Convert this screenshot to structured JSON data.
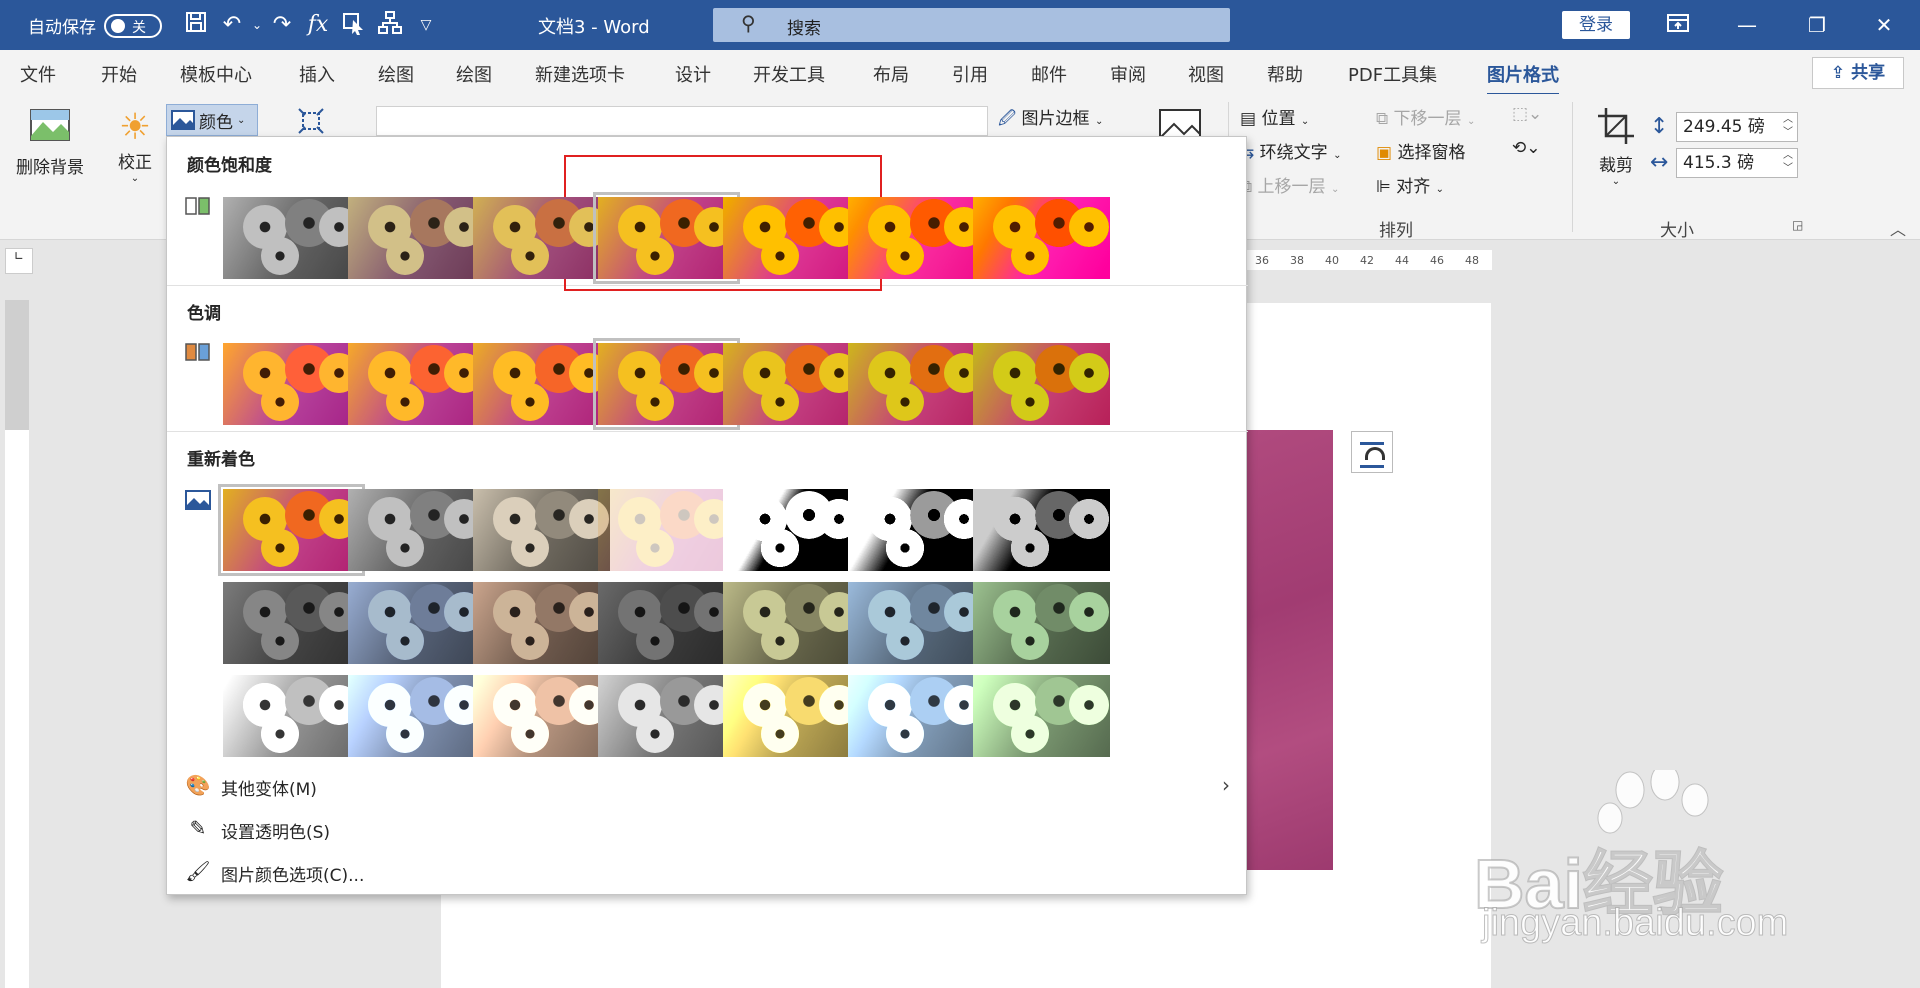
{
  "titlebar": {
    "autosave_label": "自动保存",
    "autosave_state": "关",
    "doc_title": "文档3  -  Word",
    "search_placeholder": "搜索",
    "login": "登录"
  },
  "tabs": [
    "文件",
    "开始",
    "模板中心",
    "插入",
    "绘图",
    "绘图",
    "新建选项卡",
    "设计",
    "开发工具",
    "布局",
    "引用",
    "邮件",
    "审阅",
    "视图",
    "帮助",
    "PDF工具集",
    "图片格式"
  ],
  "active_tab": "图片格式",
  "share": "共享",
  "ribbon": {
    "remove_bg": "删除背景",
    "correct": "校正",
    "color": "颜色",
    "picture_border": "图片边框",
    "position": "位置",
    "wrap_text": "环绕文字",
    "bring_forward": "上移一层",
    "send_backward": "下移一层",
    "selection_pane": "选择窗格",
    "align": "对齐",
    "arrange_group": "排列",
    "crop": "裁剪",
    "height_value": "249.45 磅",
    "width_value": "415.3 磅",
    "size_group": "大小"
  },
  "ruler": {
    "ticks": [
      "36",
      "38",
      "40",
      "42",
      "44",
      "46",
      "48"
    ]
  },
  "color_menu": {
    "saturation_title": "颜色饱和度",
    "tone_title": "色调",
    "recolor_title": "重新着色",
    "more_variations": "其他变体(M)",
    "set_transparent": "设置透明色(S)",
    "color_options": "图片颜色选项(C)..."
  },
  "colors": {
    "accent": "#2b579a",
    "highlight": "#e02020"
  },
  "watermark": {
    "brand": "Bai经验",
    "url": "jingyan.baidu.com"
  }
}
